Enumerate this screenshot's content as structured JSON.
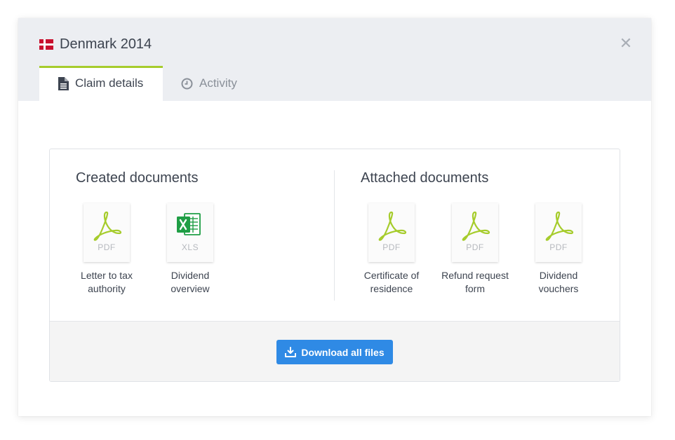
{
  "header": {
    "title": "Denmark 2014",
    "flag_icon": "denmark-flag-icon",
    "close_icon": "close-icon",
    "close_symbol": "✕"
  },
  "tabs": [
    {
      "label": "Claim details",
      "icon": "document-icon",
      "active": true
    },
    {
      "label": "Activity",
      "icon": "clock-icon",
      "active": false
    }
  ],
  "created_documents": {
    "heading": "Created documents",
    "items": [
      {
        "type": "PDF",
        "label": "Letter to tax authority",
        "line1": "Letter to tax",
        "line2": "authority"
      },
      {
        "type": "XLS",
        "label": "Dividend overview",
        "line1": "Dividend",
        "line2": "overview"
      }
    ]
  },
  "attached_documents": {
    "heading": "Attached documents",
    "items": [
      {
        "type": "PDF",
        "label": "Certificate of residence",
        "line1": "Certificate of",
        "line2": "residence"
      },
      {
        "type": "PDF",
        "label": "Refund request form",
        "line1": "Refund request",
        "line2": "form"
      },
      {
        "type": "PDF",
        "label": "Dividend vouchers",
        "line1": "Dividend",
        "line2": "vouchers"
      }
    ]
  },
  "footer": {
    "download_label": "Download all files",
    "download_icon": "download-icon"
  },
  "colors": {
    "accent_green": "#a6cc2c",
    "button_blue": "#2f8ae5",
    "flag_red": "#c8102e",
    "excel_green": "#1f9e45",
    "header_bg": "#eceef2"
  }
}
